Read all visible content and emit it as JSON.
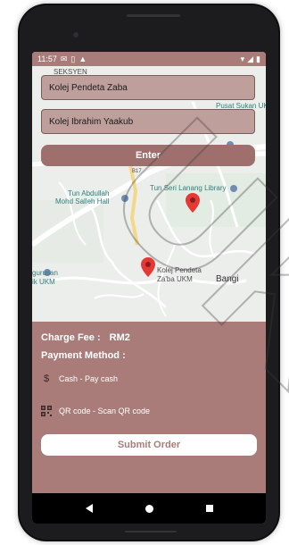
{
  "status_bar": {
    "time": "11:57"
  },
  "map": {
    "labels": {
      "seksyen": "SEKSYEN",
      "pusat_sukan": "Pusat Sukan UKM",
      "road_number": "B17",
      "tun_abdullah": "Tun Abdullah",
      "mohd_salleh": "Mohd Salleh Hall",
      "tun_seri_lanang": "Tun Seri Lanang Library",
      "kolej_pendeta_line1": "Kolej Pendeta",
      "kolej_pendeta_line2": "Za'ba UKM",
      "jurusan_line1": "gurusan",
      "jurusan_line2": "ik UKM",
      "bangi": "Bangi"
    }
  },
  "form": {
    "origin_value": "Kolej Pendeta Zaba",
    "destination_value": "Kolej Ibrahim Yaakub",
    "enter_label": "Enter"
  },
  "order": {
    "charge_label": "Charge Fee :",
    "charge_value": "RM2",
    "payment_label": "Payment Method :",
    "payment_options": [
      {
        "icon": "dollar-icon",
        "label": "Cash - Pay cash"
      },
      {
        "icon": "qr-code-icon",
        "label": "QR code - Scan QR code"
      }
    ],
    "submit_label": "Submit Order"
  },
  "watermark": {
    "text": "UKM"
  },
  "colors": {
    "primary": "#a97c79",
    "field": "#bf9f9c",
    "button": "#9e6f6c",
    "marker": "#e53935"
  }
}
